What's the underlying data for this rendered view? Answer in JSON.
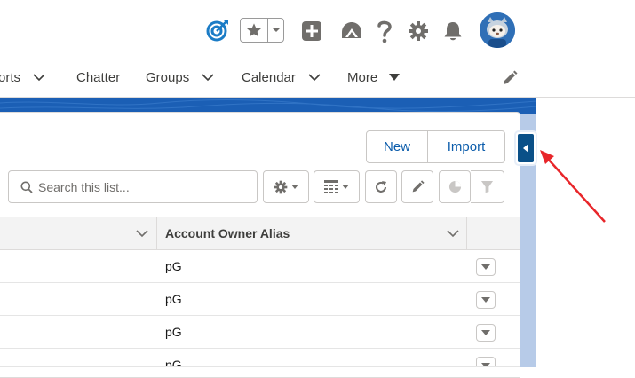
{
  "header": {
    "icons": [
      "target-icon",
      "favorite-star-icon",
      "add-icon",
      "trailhead-icon",
      "help-icon",
      "setup-gear-icon",
      "notifications-bell-icon",
      "user-avatar"
    ]
  },
  "nav": {
    "items": [
      {
        "label": "orts",
        "has_menu": true
      },
      {
        "label": "Chatter",
        "has_menu": false
      },
      {
        "label": "Groups",
        "has_menu": true
      },
      {
        "label": "Calendar",
        "has_menu": true
      },
      {
        "label": "More",
        "has_menu": true
      }
    ]
  },
  "actions": {
    "new_label": "New",
    "import_label": "Import"
  },
  "search": {
    "placeholder": "Search this list..."
  },
  "table": {
    "column_header": "Account Owner Alias",
    "rows": [
      {
        "owner_alias": "pG"
      },
      {
        "owner_alias": "pG"
      },
      {
        "owner_alias": "pG"
      },
      {
        "owner_alias": "pG"
      }
    ]
  },
  "colors": {
    "accent_blue": "#0b5cab",
    "brand_band": "#1b5fb5",
    "toggle_blue": "#0a5088",
    "annotation_red": "#e8262a"
  }
}
